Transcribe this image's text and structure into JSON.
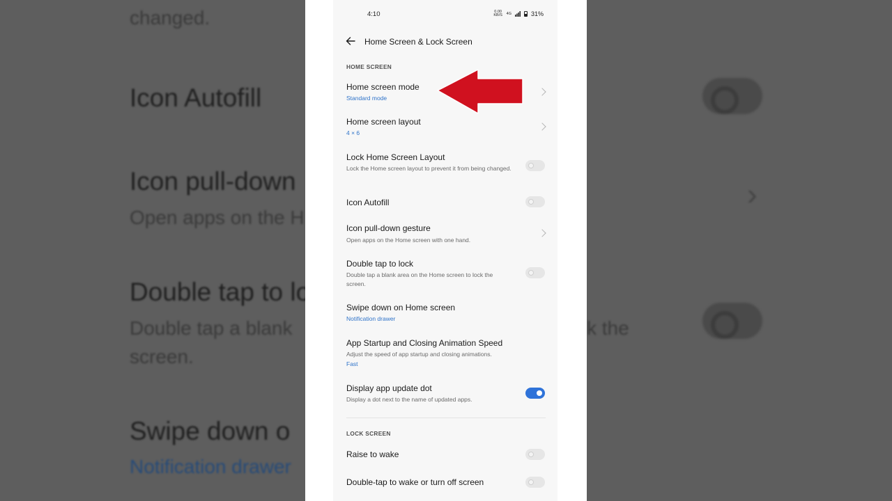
{
  "background": {
    "changed_text": "changed.",
    "icon_autofill": "Icon Autofill",
    "icon_pull_down": "Icon pull-down",
    "open_apps": "Open apps on the H",
    "double_tap": "Double tap to lo",
    "double_tap_sub": "Double tap a blank",
    "double_tap_sub_right": "k the",
    "screen": "screen.",
    "swipe_down": "Swipe down o",
    "notification_drawer": "Notification drawer"
  },
  "status_bar": {
    "time": "4:10",
    "data_speed": "0.00 KB/S",
    "network": "4G",
    "battery": "31%"
  },
  "app_bar": {
    "title": "Home Screen & Lock Screen"
  },
  "sections": {
    "home": "HOME SCREEN",
    "lock": "LOCK SCREEN"
  },
  "items": {
    "home_mode": {
      "title": "Home screen mode",
      "value": "Standard mode"
    },
    "home_layout": {
      "title": "Home screen layout",
      "value": "4 × 6"
    },
    "lock_layout": {
      "title": "Lock Home Screen Layout",
      "subtitle": "Lock the Home screen layout to prevent it from being changed.",
      "enabled": false
    },
    "icon_autofill": {
      "title": "Icon Autofill",
      "enabled": false
    },
    "pull_down": {
      "title": "Icon pull-down gesture",
      "subtitle": "Open apps on the Home screen with one hand."
    },
    "double_tap_lock": {
      "title": "Double tap to lock",
      "subtitle": "Double tap a blank area on the Home screen to lock the screen.",
      "enabled": false
    },
    "swipe_down": {
      "title": "Swipe down on Home screen",
      "value": "Notification drawer"
    },
    "anim_speed": {
      "title": "App Startup and Closing Animation Speed",
      "subtitle": "Adjust the speed of app startup and closing animations.",
      "value": "Fast"
    },
    "update_dot": {
      "title": "Display app update dot",
      "subtitle": "Display a dot next to the name of updated apps.",
      "enabled": true
    },
    "raise_wake": {
      "title": "Raise to wake",
      "enabled": false
    },
    "double_tap_wake": {
      "title": "Double-tap to wake or turn off screen",
      "enabled": false
    }
  },
  "colors": {
    "accent": "#2f73d9",
    "link": "#2f73c9",
    "annotation_arrow": "#d0111f"
  }
}
